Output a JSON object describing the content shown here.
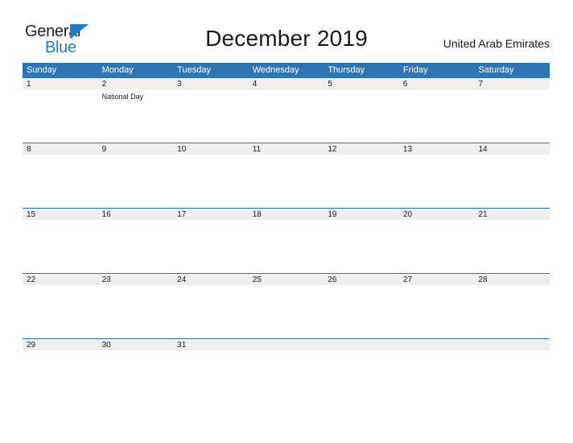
{
  "brand": {
    "line1": "General",
    "line2": "Blue",
    "flag_icon": "blue-flag-triangle",
    "color_dark": "#231f20",
    "color_blue": "#1f7dc4"
  },
  "header": {
    "title": "December 2019",
    "region": "United Arab Emirates"
  },
  "colors": {
    "header_blue": "#2e75b6",
    "date_band_gray": "#efefef",
    "text": "#1a1a1a",
    "header_text": "#ffffff"
  },
  "calendar": {
    "weekdays": [
      "Sunday",
      "Monday",
      "Tuesday",
      "Wednesday",
      "Thursday",
      "Friday",
      "Saturday"
    ],
    "weeks": [
      {
        "days": [
          {
            "date": "1",
            "events": []
          },
          {
            "date": "2",
            "events": [
              "National Day"
            ]
          },
          {
            "date": "3",
            "events": []
          },
          {
            "date": "4",
            "events": []
          },
          {
            "date": "5",
            "events": []
          },
          {
            "date": "6",
            "events": []
          },
          {
            "date": "7",
            "events": []
          }
        ]
      },
      {
        "days": [
          {
            "date": "8",
            "events": []
          },
          {
            "date": "9",
            "events": []
          },
          {
            "date": "10",
            "events": []
          },
          {
            "date": "11",
            "events": []
          },
          {
            "date": "12",
            "events": []
          },
          {
            "date": "13",
            "events": []
          },
          {
            "date": "14",
            "events": []
          }
        ]
      },
      {
        "days": [
          {
            "date": "15",
            "events": []
          },
          {
            "date": "16",
            "events": []
          },
          {
            "date": "17",
            "events": []
          },
          {
            "date": "18",
            "events": []
          },
          {
            "date": "19",
            "events": []
          },
          {
            "date": "20",
            "events": []
          },
          {
            "date": "21",
            "events": []
          }
        ]
      },
      {
        "days": [
          {
            "date": "22",
            "events": []
          },
          {
            "date": "23",
            "events": []
          },
          {
            "date": "24",
            "events": []
          },
          {
            "date": "25",
            "events": []
          },
          {
            "date": "26",
            "events": []
          },
          {
            "date": "27",
            "events": []
          },
          {
            "date": "28",
            "events": []
          }
        ]
      },
      {
        "days": [
          {
            "date": "29",
            "events": []
          },
          {
            "date": "30",
            "events": []
          },
          {
            "date": "31",
            "events": []
          },
          {
            "date": "",
            "events": []
          },
          {
            "date": "",
            "events": []
          },
          {
            "date": "",
            "events": []
          },
          {
            "date": "",
            "events": []
          }
        ]
      }
    ]
  }
}
